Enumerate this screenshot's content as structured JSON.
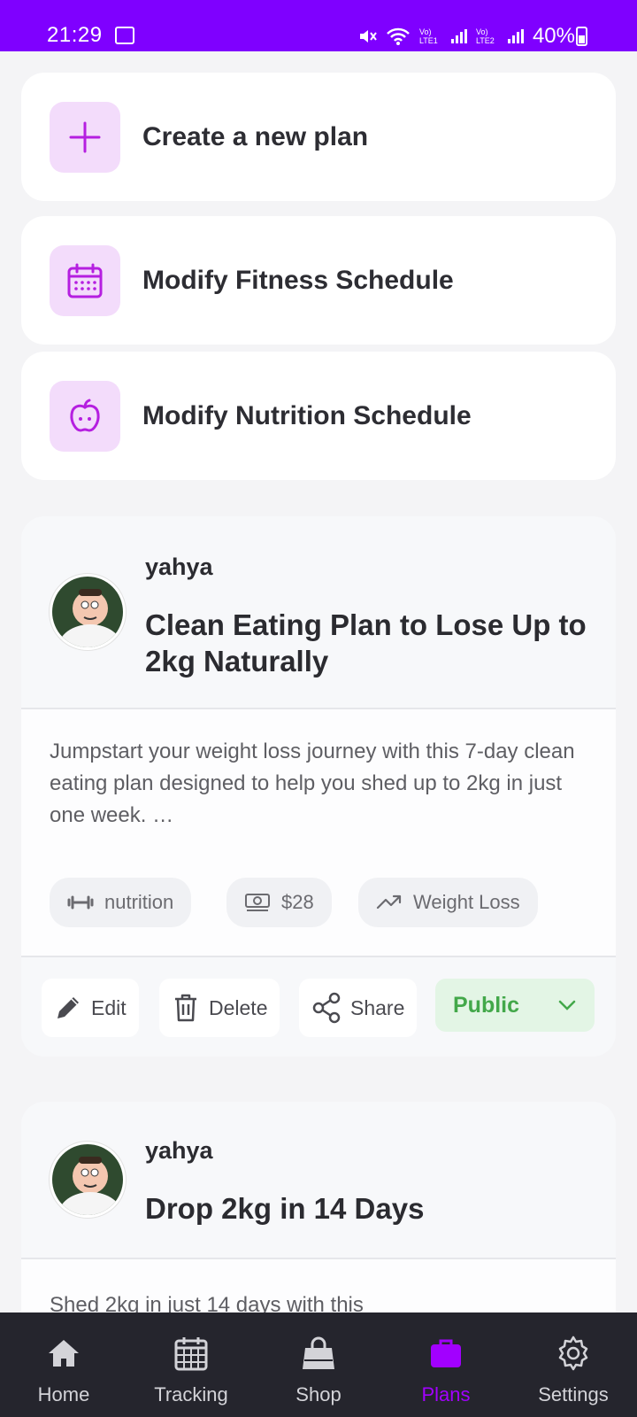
{
  "status_bar": {
    "time": "21:29",
    "battery": "40%",
    "sim1": "Vo) LTE1",
    "sim2": "Vo) LTE2"
  },
  "actions": [
    {
      "label": "Create a new plan",
      "icon": "plus-icon"
    },
    {
      "label": "Modify Fitness Schedule",
      "icon": "calendar-icon"
    },
    {
      "label": "Modify Nutrition Schedule",
      "icon": "apple-icon"
    }
  ],
  "plans": [
    {
      "author": "yahya",
      "title": "Clean Eating Plan to Lose Up to 2kg Naturally",
      "description": "Jumpstart your weight loss journey with this 7-day clean eating plan designed to help you shed up to 2kg in just one week. …",
      "tags": {
        "type": "nutrition",
        "price": "$28",
        "goal": "Weight Loss"
      },
      "buttons": {
        "edit": "Edit",
        "delete": "Delete",
        "share": "Share"
      },
      "visibility": "Public"
    },
    {
      "author": "yahya",
      "title": "Drop 2kg in 14 Days",
      "description": "Shed 2kg in just 14 days with this"
    }
  ],
  "nav": {
    "home": "Home",
    "tracking": "Tracking",
    "shop": "Shop",
    "plans": "Plans",
    "settings": "Settings",
    "active": "Plans"
  },
  "colors": {
    "accent": "#7f00ff",
    "active_nav": "#a200ff",
    "public_green": "#43a84a",
    "icon_tile": "#f3dcfb"
  }
}
